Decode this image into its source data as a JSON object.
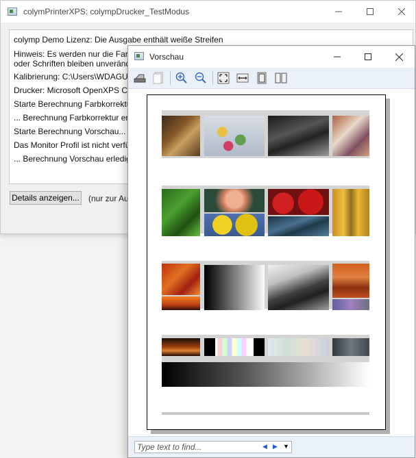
{
  "main_window": {
    "title": "colymPrinterXPS: colympDrucker_TestModus",
    "log_lines": [
      "colymp Demo Lizenz: Die Ausgabe enthält weiße Streifen",
      "Hinweis: Es werden nur die Farb",
      "oder Schriften bleiben unveränd",
      "Kalibrierung: C:\\Users\\WDAGUti",
      "Drucker: Microsoft OpenXPS Cla",
      "Starte Berechnung Farbkorrektur",
      "... Berechnung Farbkorrektur erl",
      "Starte Berechnung Vorschau...",
      "Das Monitor Profil ist nicht verfü",
      "... Berechnung Vorschau erledig"
    ],
    "details_button": "Details anzeigen...",
    "note": "(nur zur Au"
  },
  "preview_window": {
    "title": "Vorschau",
    "toolbar_icons": [
      "print-icon",
      "copy-icon",
      "zoom-in-icon",
      "zoom-out-icon",
      "actual-size-icon",
      "page-width-icon",
      "whole-page-icon",
      "two-pages-icon"
    ],
    "find_placeholder": "Type text to find..."
  },
  "colors": {
    "toolbar_bg": "#eaf0f8",
    "window_bg": "#f0f0f0",
    "accent_blue": "#1a5fd0"
  }
}
